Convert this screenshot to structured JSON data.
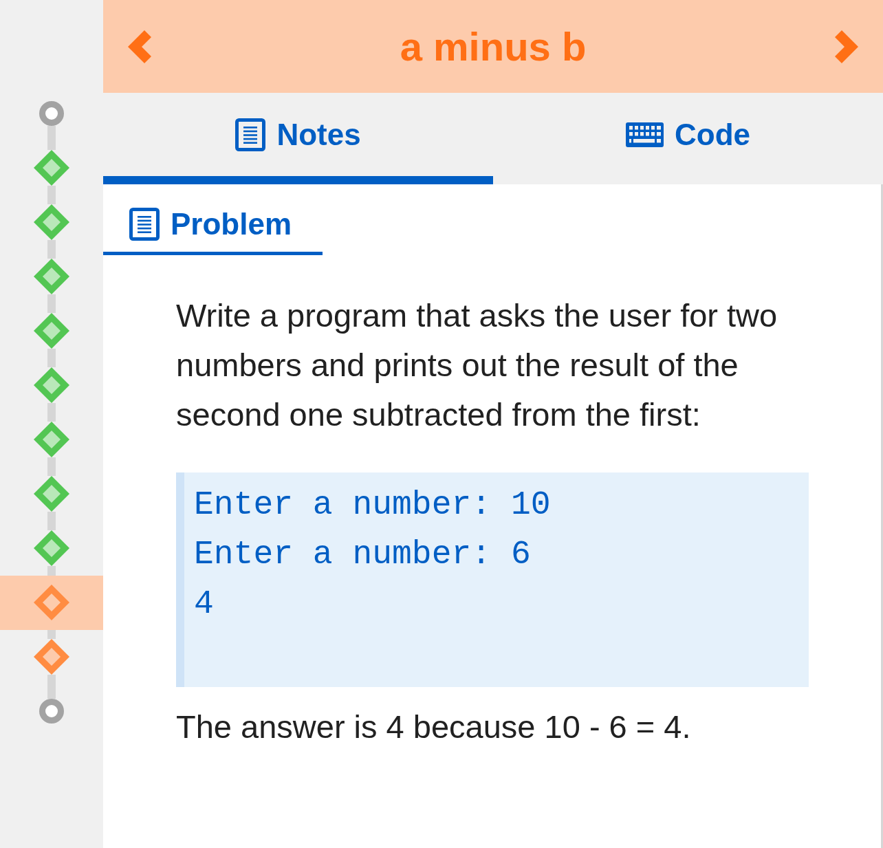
{
  "sidebar": {
    "steps": [
      {
        "kind": "start"
      },
      {
        "kind": "exercise",
        "completed": true,
        "selected": false
      },
      {
        "kind": "exercise",
        "completed": true,
        "selected": false
      },
      {
        "kind": "exercise",
        "completed": true,
        "selected": false
      },
      {
        "kind": "exercise",
        "completed": true,
        "selected": false
      },
      {
        "kind": "exercise",
        "completed": true,
        "selected": false
      },
      {
        "kind": "exercise",
        "completed": true,
        "selected": false
      },
      {
        "kind": "exercise",
        "completed": true,
        "selected": false
      },
      {
        "kind": "exercise",
        "completed": true,
        "selected": false
      },
      {
        "kind": "exercise",
        "completed": false,
        "selected": true
      },
      {
        "kind": "exercise",
        "completed": false,
        "selected": false
      },
      {
        "kind": "end"
      }
    ]
  },
  "header": {
    "title": "a minus b"
  },
  "tabs": [
    {
      "kind": "notes",
      "label": "Notes",
      "selected": true
    },
    {
      "kind": "code",
      "label": "Code",
      "selected": false
    }
  ],
  "section": {
    "heading": "Problem"
  },
  "content": [
    {
      "kind": "paragraph",
      "text": "Write a program that asks the user for two numbers and prints out the result of the second one subtracted from the first:"
    },
    {
      "kind": "code",
      "lines": [
        "Enter a number: 10",
        "Enter a number: 6",
        "4"
      ]
    },
    {
      "kind": "paragraph",
      "text": "The answer is 4 because 10 - 6 = 4."
    }
  ]
}
